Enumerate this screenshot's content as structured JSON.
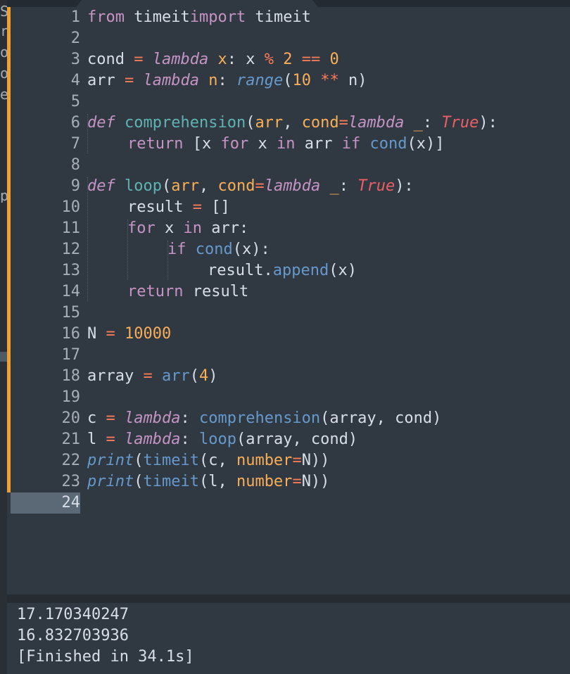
{
  "left_strip_fragments": [
    "S",
    "r",
    "o",
    "o",
    "e",
    "p"
  ],
  "editor": {
    "active_line": 24,
    "lines": [
      [
        [
          "kw",
          "from"
        ],
        [
          "",
          "timeit"
        ],
        [
          "kw",
          "import"
        ],
        [
          "",
          "timeit"
        ]
      ],
      [],
      [
        [
          "",
          "cond "
        ],
        [
          "op",
          "="
        ],
        [
          "",
          ""
        ],
        [
          "kwi",
          "lambda"
        ],
        [
          "prm",
          "x"
        ],
        [
          "",
          ": x "
        ],
        [
          "op",
          "%"
        ],
        [
          "num",
          "2"
        ],
        [
          "op",
          "=="
        ],
        [
          "num",
          "0"
        ]
      ],
      [
        [
          "",
          "arr "
        ],
        [
          "op",
          "="
        ],
        [
          "",
          ""
        ],
        [
          "kwi",
          "lambda"
        ],
        [
          "prm",
          "n"
        ],
        [
          "",
          ": "
        ],
        [
          "bii",
          "range"
        ],
        [
          "",
          "("
        ],
        [
          "num",
          "10"
        ],
        [
          "op",
          "**"
        ],
        [
          "",
          "n)"
        ]
      ],
      [],
      [
        [
          "kwi",
          "def"
        ],
        [
          "fn",
          "comprehension"
        ],
        [
          "",
          "("
        ],
        [
          "prm",
          "arr"
        ],
        [
          "",
          ", "
        ],
        [
          "prm",
          "cond"
        ],
        [
          "op",
          "="
        ],
        [
          "kwi",
          "lambda"
        ],
        [
          "prm",
          "_"
        ],
        [
          "",
          ": "
        ],
        [
          "const",
          "True"
        ],
        [
          "",
          "):"
        ]
      ],
      [
        [
          "kw",
          "return"
        ],
        [
          "",
          "[x "
        ],
        [
          "kw",
          "for"
        ],
        [
          "",
          "x "
        ],
        [
          "kw",
          "in"
        ],
        [
          "",
          "arr "
        ],
        [
          "kw",
          "if"
        ],
        [
          "bi",
          "cond"
        ],
        [
          "",
          "(x)]"
        ]
      ],
      [],
      [
        [
          "kwi",
          "def"
        ],
        [
          "fn",
          "loop"
        ],
        [
          "",
          "("
        ],
        [
          "prm",
          "arr"
        ],
        [
          "",
          ", "
        ],
        [
          "prm",
          "cond"
        ],
        [
          "op",
          "="
        ],
        [
          "kwi",
          "lambda"
        ],
        [
          "prm",
          "_"
        ],
        [
          "",
          ": "
        ],
        [
          "const",
          "True"
        ],
        [
          "",
          "):"
        ]
      ],
      [
        [
          "",
          "result "
        ],
        [
          "op",
          "="
        ],
        [
          "",
          "[]"
        ]
      ],
      [
        [
          "kw",
          "for"
        ],
        [
          "",
          "x "
        ],
        [
          "kw",
          "in"
        ],
        [
          "",
          "arr:"
        ]
      ],
      [
        [
          "kw",
          "if"
        ],
        [
          "bi",
          "cond"
        ],
        [
          "",
          "(x):"
        ]
      ],
      [
        [
          "",
          "result."
        ],
        [
          "bi",
          "append"
        ],
        [
          "",
          "(x)"
        ]
      ],
      [
        [
          "kw",
          "return"
        ],
        [
          "",
          "result"
        ]
      ],
      [],
      [
        [
          "",
          "N "
        ],
        [
          "op",
          "="
        ],
        [
          "num",
          "10000"
        ]
      ],
      [],
      [
        [
          "",
          "array "
        ],
        [
          "op",
          "="
        ],
        [
          "bi",
          "arr"
        ],
        [
          "",
          "("
        ],
        [
          "num",
          "4"
        ],
        [
          "",
          ")"
        ]
      ],
      [],
      [
        [
          "",
          "c "
        ],
        [
          "op",
          "="
        ],
        [
          "kwi",
          "lambda"
        ],
        [
          "",
          ": "
        ],
        [
          "bi",
          "comprehension"
        ],
        [
          "",
          "(array, cond)"
        ]
      ],
      [
        [
          "",
          "l "
        ],
        [
          "op",
          "="
        ],
        [
          "kwi",
          "lambda"
        ],
        [
          "",
          ": "
        ],
        [
          "bi",
          "loop"
        ],
        [
          "",
          "(array, cond)"
        ]
      ],
      [
        [
          "bii",
          "print"
        ],
        [
          "",
          "("
        ],
        [
          "bi",
          "timeit"
        ],
        [
          "",
          "(c, "
        ],
        [
          "prm",
          "number"
        ],
        [
          "op",
          "="
        ],
        [
          "",
          "N))"
        ]
      ],
      [
        [
          "bii",
          "print"
        ],
        [
          "",
          "("
        ],
        [
          "bi",
          "timeit"
        ],
        [
          "",
          "(l, "
        ],
        [
          "prm",
          "number"
        ],
        [
          "op",
          "="
        ],
        [
          "",
          "N))"
        ]
      ],
      []
    ]
  },
  "output": {
    "lines": [
      "17.170340247",
      "16.832703936",
      "[Finished in 34.1s]"
    ]
  },
  "colors": {
    "background": "#303841",
    "accent_bar": "#f0a030",
    "keyword": "#c594c5",
    "function": "#5fb3b3",
    "builtin": "#6699cc",
    "operator": "#f97b58",
    "number": "#f9ae58",
    "constant": "#ec5f66"
  }
}
